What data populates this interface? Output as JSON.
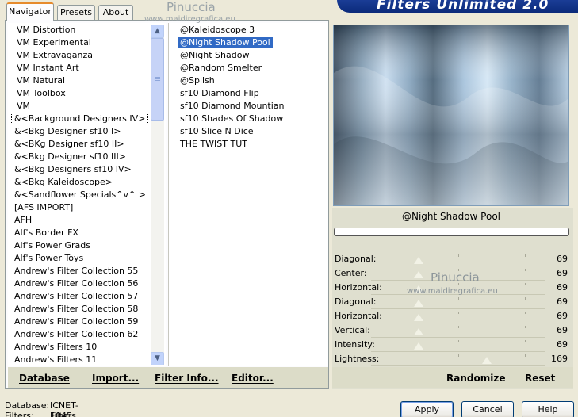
{
  "tabs": [
    {
      "label": "Navigator",
      "active": true
    },
    {
      "label": "Presets",
      "active": false
    },
    {
      "label": "About",
      "active": false
    }
  ],
  "app_title": "Filters Unlimited 2.0",
  "watermark": {
    "name": "Pinuccia",
    "url": "www.maidiregrafica.eu"
  },
  "categories": [
    "VM Distortion",
    "VM Experimental",
    "VM Extravaganza",
    "VM Instant Art",
    "VM Natural",
    "VM Toolbox",
    "VM",
    "&<Background Designers IV>",
    "&<Bkg Designer sf10 I>",
    "&<BKg Designer sf10 II>",
    "&<Bkg Designer sf10 III>",
    "&<Bkg Designers sf10 IV>",
    "&<Bkg Kaleidoscope>",
    "&<Sandflower Specials^v^ >",
    "[AFS IMPORT]",
    "AFH",
    "Alf's Border FX",
    "Alf's Power Grads",
    "Alf's Power Toys",
    "Andrew's Filter Collection 55",
    "Andrew's Filter Collection 56",
    "Andrew's Filter Collection 57",
    "Andrew's Filter Collection 58",
    "Andrew's Filter Collection 59",
    "Andrew's Filter Collection 62",
    "Andrew's Filters 10",
    "Andrew's Filters 11"
  ],
  "selected_category": "&<Background Designers IV>",
  "filters": [
    "@Kaleidoscope 3",
    "@Night Shadow Pool",
    "@Night Shadow",
    "@Random Smelter",
    "@Splish",
    "sf10 Diamond Flip",
    "sf10 Diamond Mountian",
    "sf10 Shades Of Shadow",
    "sf10 Slice N Dice",
    "THE TWIST TUT"
  ],
  "selected_filter": "@Night Shadow Pool",
  "left_buttons": {
    "database": "Database",
    "import": "Import...",
    "filter_info": "Filter Info...",
    "editor": "Editor..."
  },
  "preview_filter_name": "@Night Shadow Pool",
  "progress": 0,
  "sliders": [
    {
      "label": "Diagonal:",
      "value": 69
    },
    {
      "label": "Center:",
      "value": 69
    },
    {
      "label": "Horizontal:",
      "value": 69
    },
    {
      "label": "Diagonal:",
      "value": 69
    },
    {
      "label": "Horizontal:",
      "value": 69
    },
    {
      "label": "Vertical:",
      "value": 69
    },
    {
      "label": "Intensity:",
      "value": 69
    },
    {
      "label": "Lightness:",
      "value": 169
    }
  ],
  "slider_max": 255,
  "right_buttons": {
    "randomize": "Randomize",
    "reset": "Reset"
  },
  "status": {
    "database_label": "Database:",
    "database_value": "ICNET-Filters",
    "filters_label": "Filters:",
    "filters_value": "1045"
  },
  "dialog_buttons": {
    "apply": "Apply",
    "cancel": "Cancel",
    "help": "Help"
  },
  "colors": {
    "selection": "#316ac5",
    "window": "#ece9d8",
    "banner": "#0b2a7a"
  }
}
